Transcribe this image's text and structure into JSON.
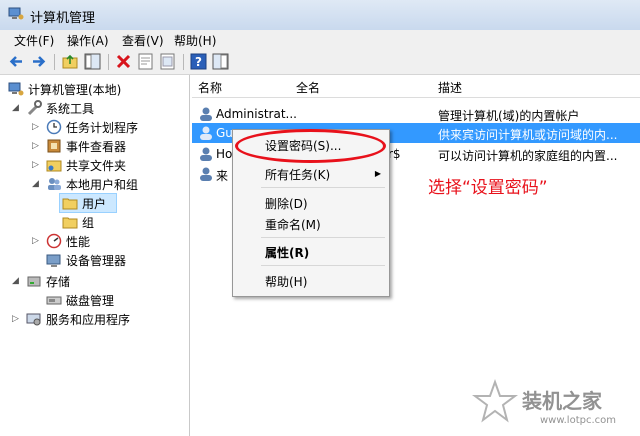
{
  "window": {
    "title": "计算机管理"
  },
  "menu": [
    "文件(F)",
    "操作(A)",
    "查看(V)",
    "帮助(H)"
  ],
  "toolbar_icons": [
    "back-icon",
    "forward-icon",
    "up-folder-icon",
    "show-tree-icon",
    "delete-icon",
    "properties-icon",
    "export-icon",
    "help-icon",
    "view-icon"
  ],
  "tree": [
    {
      "label": "计算机管理(本地)"
    },
    {
      "label": "系统工具"
    },
    {
      "label": "任务计划程序"
    },
    {
      "label": "事件查看器"
    },
    {
      "label": "共享文件夹"
    },
    {
      "label": "本地用户和组"
    },
    {
      "label": "用户"
    },
    {
      "label": "组"
    },
    {
      "label": "性能"
    },
    {
      "label": "设备管理器"
    },
    {
      "label": "存储"
    },
    {
      "label": "磁盘管理"
    },
    {
      "label": "服务和应用程序"
    }
  ],
  "list": {
    "columns": [
      "名称",
      "全名",
      "描述"
    ],
    "rows": [
      {
        "name": "Administrat...",
        "fullname": "",
        "desc": "管理计算机(域)的内置帐户"
      },
      {
        "name": "Gu",
        "fullname": "",
        "desc": "供来宾访问计算机或访问域的内..."
      },
      {
        "name": "Ho",
        "fullname": "r$",
        "desc": "可以访问计算机的家庭组的内置..."
      },
      {
        "name": "来",
        "fullname": "",
        "desc": ""
      }
    ]
  },
  "context_menu": {
    "items": [
      "设置密码(S)...",
      "所有任务(K)",
      "删除(D)",
      "重命名(M)",
      "属性(R)",
      "帮助(H)"
    ]
  },
  "annotation": "选择“设置密码”",
  "watermark": {
    "brand": "装机之家",
    "url": "www.lotpc.com"
  },
  "colors": {
    "selection": "#3399ff",
    "annotation": "#e8111b"
  }
}
